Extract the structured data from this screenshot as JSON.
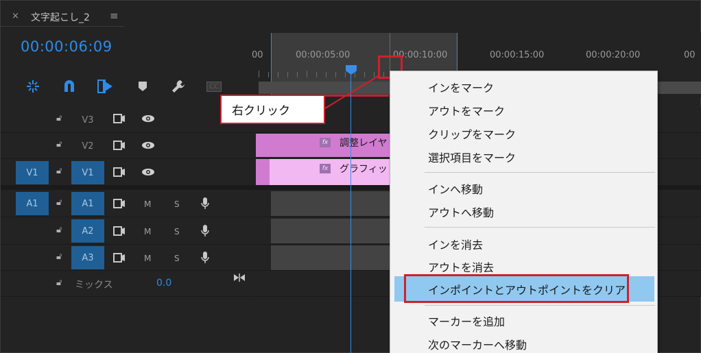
{
  "header": {
    "close_glyph": "×",
    "sequence_name": "文字起こし_2",
    "menu_glyph": "≡",
    "timecode": "00:00:06:09"
  },
  "ruler": {
    "labels": [
      "00",
      "00:00:05:00",
      "00:00:10:00",
      "00:00:15:00",
      "00:00:20:00",
      "00"
    ]
  },
  "tools": {
    "cc_label": "CC"
  },
  "tracks": {
    "video": [
      {
        "label": "V3",
        "target": "",
        "active": false
      },
      {
        "label": "V2",
        "target": "",
        "active": false
      },
      {
        "label": "V1",
        "target": "V1",
        "active": true
      }
    ],
    "audio": [
      {
        "label": "A1",
        "target": "A1",
        "m": "M",
        "s": "S"
      },
      {
        "label": "A2",
        "target": "",
        "m": "M",
        "s": "S"
      },
      {
        "label": "A3",
        "target": "",
        "m": "M",
        "s": "S"
      }
    ],
    "mix_label": "ミックス",
    "mix_value": "0.0"
  },
  "clips": {
    "adjustment": {
      "fx": "fx",
      "label": "調整レイヤ"
    },
    "graphic": {
      "fx": "fx",
      "label": "グラフィッ"
    }
  },
  "callout": {
    "text": "右クリック"
  },
  "context_menu": {
    "items": [
      "インをマーク",
      "アウトをマーク",
      "クリップをマーク",
      "選択項目をマーク",
      "インへ移動",
      "アウトへ移動",
      "インを消去",
      "アウトを消去",
      "インポイントとアウトポイントをクリア",
      "マーカーを追加",
      "次のマーカーへ移動"
    ],
    "highlighted_index": 8
  },
  "colors": {
    "accent": "#2d8ceb",
    "track_target": "#1f5f96",
    "clip_adjustment": "#d07bd0",
    "clip_graphic": "#f2b8f2",
    "highlight": "#90c8f0",
    "annotation_red": "#d0202c"
  }
}
